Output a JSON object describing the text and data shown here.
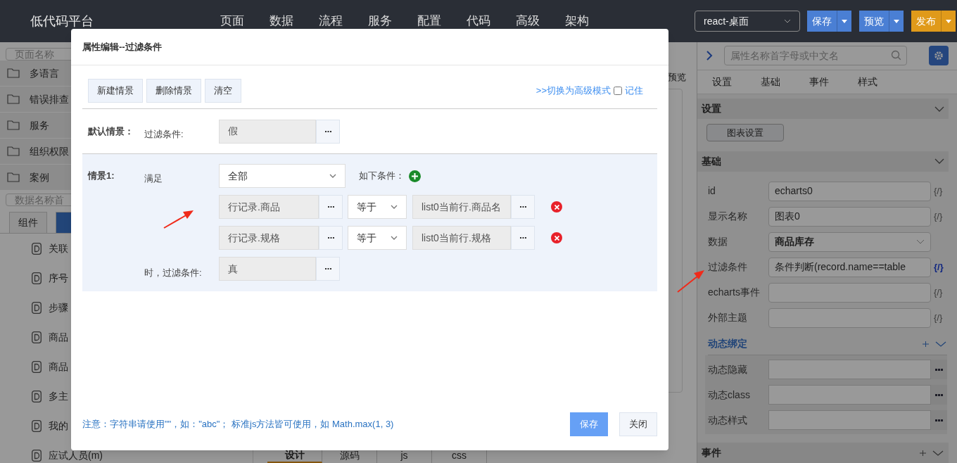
{
  "topbar": {
    "logo": "低代码平台",
    "nav": [
      "页面",
      "数据",
      "流程",
      "服务",
      "配置",
      "代码",
      "高级",
      "架构"
    ],
    "device_select": "react-桌面",
    "buttons": [
      {
        "label": "保存",
        "color": "#4a7fd4"
      },
      {
        "label": "预览",
        "color": "#4a7fd4"
      },
      {
        "label": "发布",
        "color": "#e09a1a"
      }
    ]
  },
  "left_panel": {
    "search_placeholder": "页面名称",
    "folders": [
      "多语言",
      "错误排查",
      "服务",
      "组织权限",
      "案例"
    ],
    "data_search_placeholder": "数据名称首",
    "tabs": [
      {
        "label": "组件",
        "selected": false
      },
      {
        "selected": true
      }
    ],
    "items": [
      "关联",
      "序号",
      "步骤",
      "商品",
      "商品",
      "多主",
      "我的",
      "应试人员(m)"
    ]
  },
  "canvas": {
    "label": "预览",
    "tabs": [
      {
        "label": "设计",
        "selected": true
      },
      {
        "label": "源码",
        "selected": false
      },
      {
        "label": "js",
        "selected": false
      },
      {
        "label": "css",
        "selected": false
      }
    ]
  },
  "right_panel": {
    "search_placeholder": "属性名称首字母或中文名",
    "tabs": [
      "设置",
      "基础",
      "事件",
      "样式"
    ],
    "settings": {
      "title": "设置",
      "button": "图表设置"
    },
    "basic": {
      "title": "基础",
      "rows": [
        {
          "label": "id",
          "value": "echarts0",
          "kind": "text",
          "binding": "{/}",
          "bound": false
        },
        {
          "label": "显示名称",
          "value": "图表0",
          "kind": "text",
          "binding": "{/}",
          "bound": false
        },
        {
          "label": "数据",
          "value": "商品库存",
          "kind": "select"
        },
        {
          "label": "过滤条件",
          "value": "条件判断(record.name==table",
          "kind": "text",
          "binding": "{/}",
          "bound": true
        },
        {
          "label": "echarts事件",
          "kind": "text",
          "binding": "{/}",
          "bound": false
        },
        {
          "label": "外部主题",
          "kind": "text",
          "binding": "{/}",
          "bound": false
        }
      ]
    },
    "dynamic": {
      "title": "动态绑定",
      "rows": [
        "动态隐藏",
        "动态class",
        "动态样式"
      ]
    },
    "events": {
      "title": "事件"
    }
  },
  "dialog": {
    "title": "属性编辑--过滤条件",
    "toolbar": [
      "新建情景",
      "删除情景",
      "清空"
    ],
    "advanced_link": ">>切换为高级模式",
    "remember": {
      "label": "记住",
      "checked": false
    },
    "default": {
      "label": "默认情景：",
      "field_label": "过滤条件:",
      "value": "假"
    },
    "scenarios": [
      {
        "label": "情景1:",
        "match_label": "满足",
        "match": "全部",
        "suffix": "如下条件：",
        "conditions": [
          {
            "left": "行记录.商品",
            "op": "等于",
            "right": "list0当前行.商品名"
          },
          {
            "left": "行记录.规格",
            "op": "等于",
            "right": "list0当前行.规格"
          }
        ],
        "result_label": "时，过滤条件:",
        "result": "真"
      }
    ],
    "note": "注意：字符串请使用\"\"，如：\"abc\"； 标准js方法皆可使用，如 Math.max(1, 3)",
    "buttons": [
      {
        "label": "保存",
        "kind": "primary"
      },
      {
        "label": "关闭",
        "kind": "default"
      }
    ]
  }
}
